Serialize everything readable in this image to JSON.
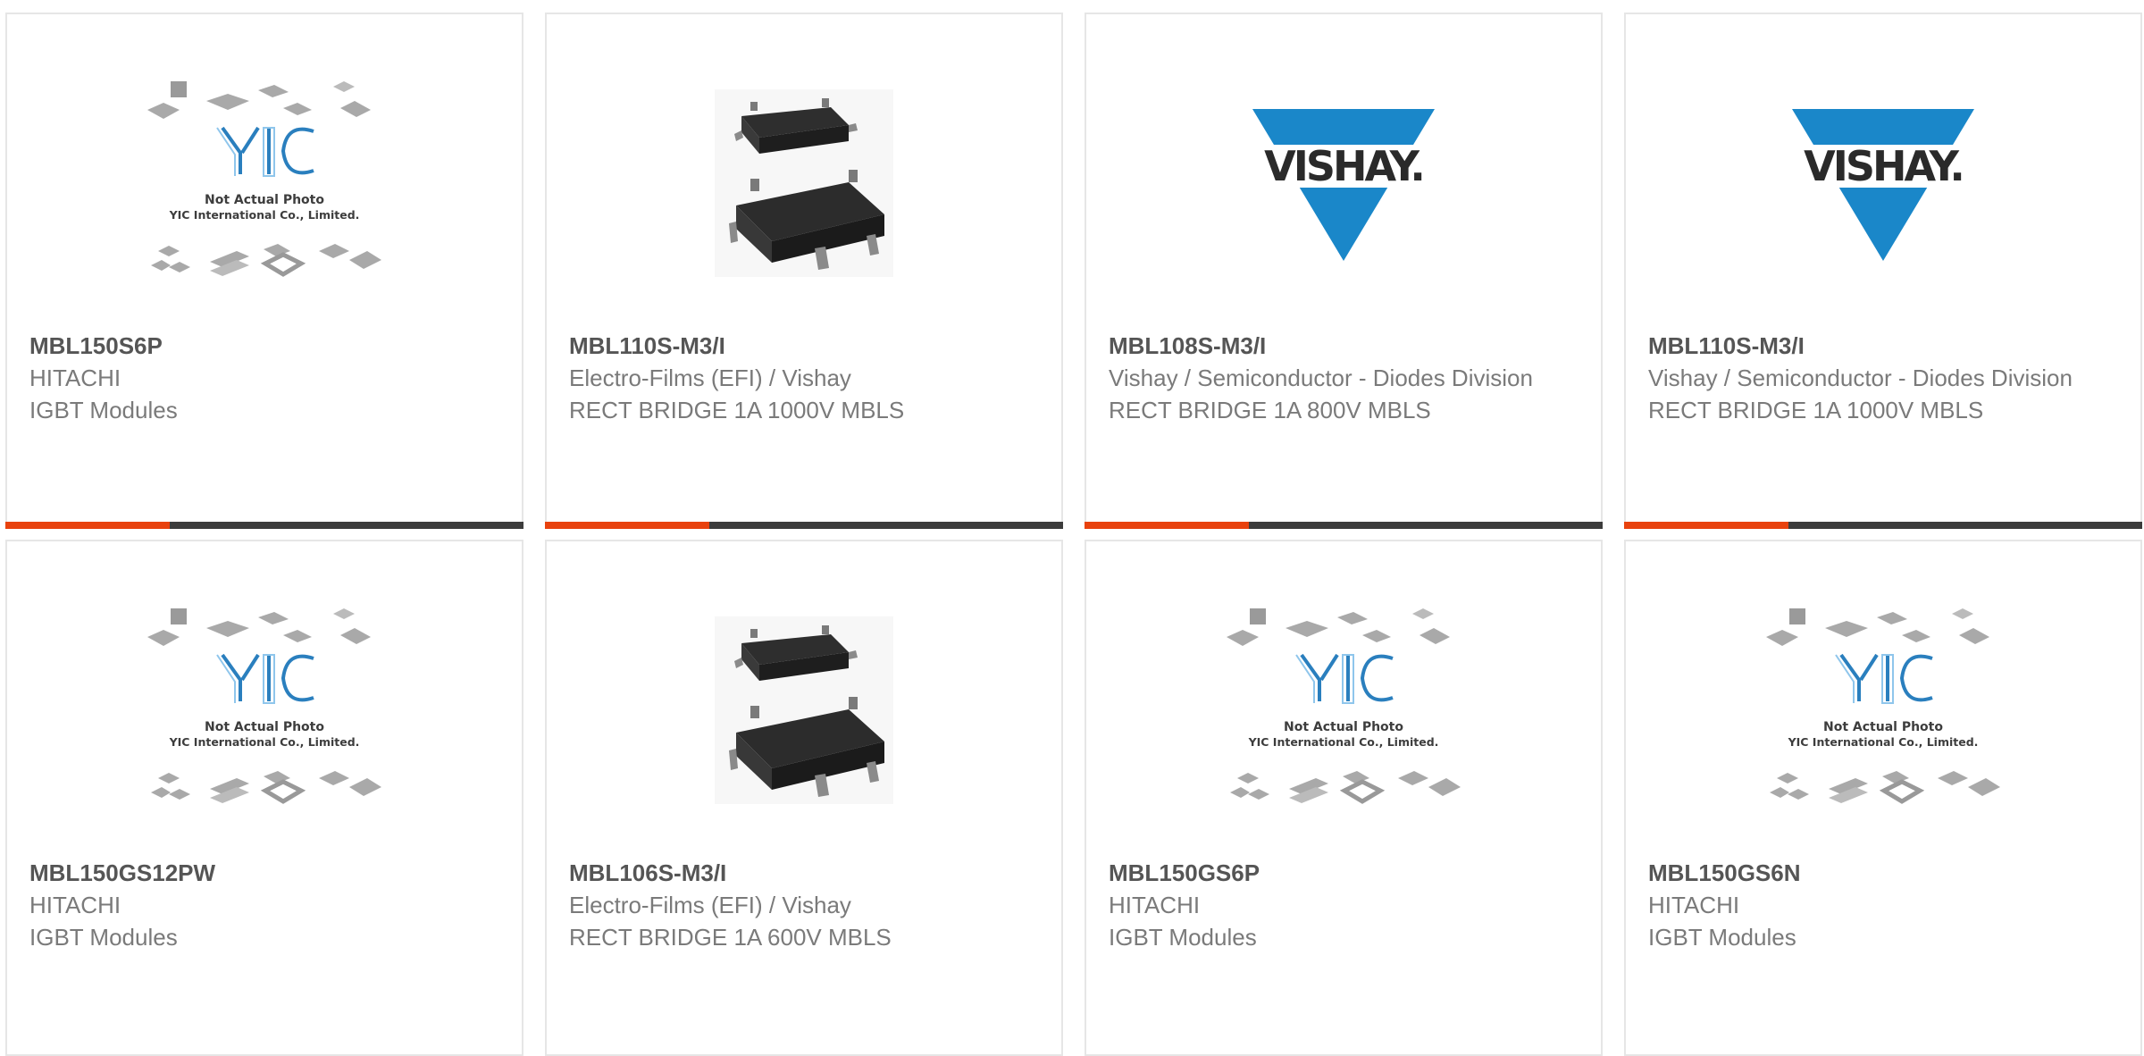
{
  "theme": {
    "accent": "#e8420e",
    "bar_dark": "#3c3c3c",
    "logo_blue": "#1a87c9"
  },
  "placeholder": {
    "brand": "YIC",
    "line1": "Not Actual Photo",
    "line2": "YIC International Co., Limited."
  },
  "vishay_logo": {
    "text": "VISHAY."
  },
  "products": [
    {
      "part": "MBL150S6P",
      "manufacturer": "HITACHI",
      "description": "IGBT Modules",
      "image": "yic-placeholder"
    },
    {
      "part": "MBL110S-M3/I",
      "manufacturer": "Electro-Films (EFI) / Vishay",
      "description": "RECT BRIDGE 1A 1000V MBLS",
      "image": "mbls-package"
    },
    {
      "part": "MBL108S-M3/I",
      "manufacturer": "Vishay / Semiconductor - Diodes Division",
      "description": "RECT BRIDGE 1A 800V MBLS",
      "image": "vishay-logo"
    },
    {
      "part": "MBL110S-M3/I",
      "manufacturer": "Vishay / Semiconductor - Diodes Division",
      "description": "RECT BRIDGE 1A 1000V MBLS",
      "image": "vishay-logo"
    },
    {
      "part": "MBL150GS12PW",
      "manufacturer": "HITACHI",
      "description": "IGBT Modules",
      "image": "yic-placeholder"
    },
    {
      "part": "MBL106S-M3/I",
      "manufacturer": "Electro-Films (EFI) / Vishay",
      "description": "RECT BRIDGE 1A 600V MBLS",
      "image": "mbls-package"
    },
    {
      "part": "MBL150GS6P",
      "manufacturer": "HITACHI",
      "description": "IGBT Modules",
      "image": "yic-placeholder"
    },
    {
      "part": "MBL150GS6N",
      "manufacturer": "HITACHI",
      "description": "IGBT Modules",
      "image": "yic-placeholder"
    }
  ]
}
